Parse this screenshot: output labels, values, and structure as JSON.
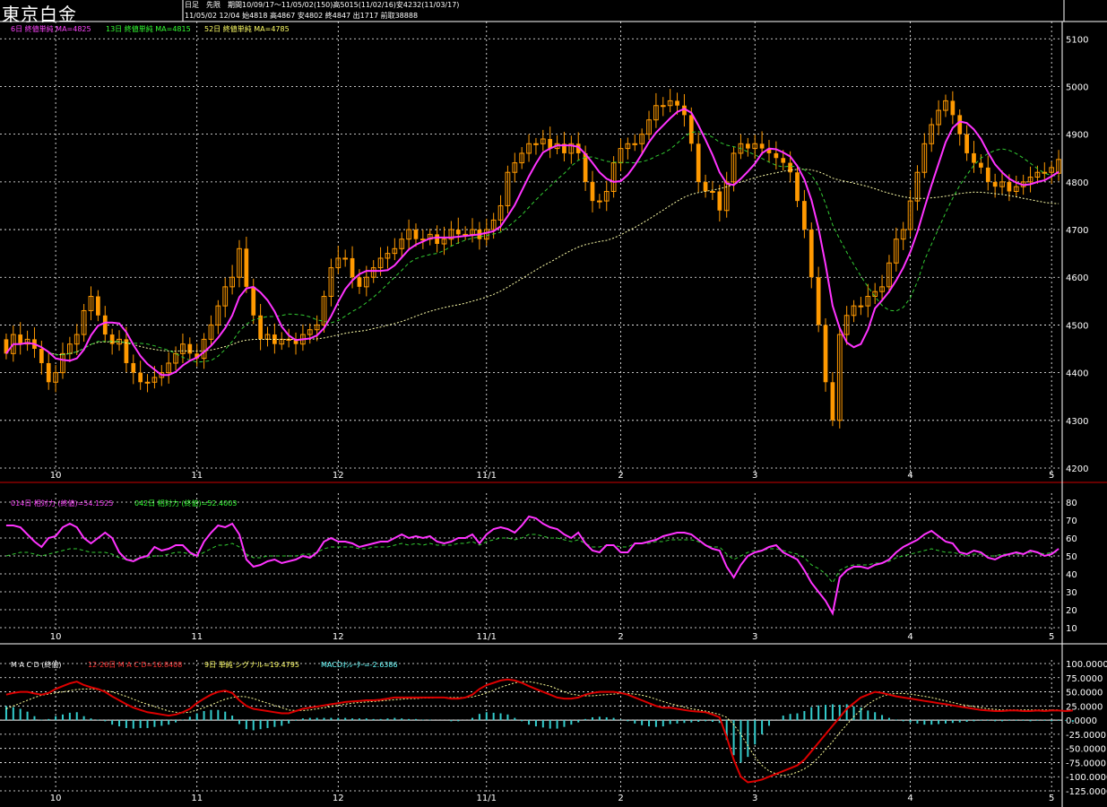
{
  "header": {
    "title": "東京白金",
    "info_line1": "日足　先限　期間10/09/17～11/05/02(150)高5015(11/02/16)安4232(11/03/17)",
    "info_line2": "11/05/02 12/04 始4818 高4867 安4802 終4847 出1717 前取38888"
  },
  "legend_price": [
    {
      "text": "6日 終値単純 MA=4825",
      "color": "#ff44ff"
    },
    {
      "text": "13日 終値単純 MA=4815",
      "color": "#33ff33"
    },
    {
      "text": "52日 終値単純 MA=4785",
      "color": "#ffff66"
    }
  ],
  "legend_rsi": [
    {
      "text": "014日 相対力 (終値)=54.1525",
      "color": "#ff44ff"
    },
    {
      "text": "042日 相対力 (終値)=52.4003",
      "color": "#33ff33"
    }
  ],
  "legend_macd": [
    {
      "text": "M A C D  (終値)",
      "color": "#ffffff"
    },
    {
      "text": "12-26日 M A C D=16.8408",
      "color": "#ff3333"
    },
    {
      "text": "9日 単純 シグナル=19.4795",
      "color": "#ffff66"
    },
    {
      "text": "MACDｵｼﾚｰﾀｰ=-2.6386",
      "color": "#66ffff"
    }
  ],
  "colors": {
    "candle": "#ff9900",
    "ma6": "#ff33ff",
    "ma13": "#33cc33",
    "ma52": "#ffffaa",
    "rsi14": "#ff33ff",
    "rsi42": "#33cc33",
    "macd": "#dd0000",
    "signal": "#ffff99",
    "osc": "#33cccc",
    "grid": "#ffffff",
    "frame_accent": "#cc0000"
  },
  "chart_data": [
    {
      "type": "candlestick",
      "title": "東京白金",
      "period": "10/09/17～11/05/02",
      "count": 150,
      "ylim": [
        4200,
        5140
      ],
      "y_ticks": [
        4200,
        4300,
        4400,
        4500,
        4600,
        4700,
        4800,
        4900,
        5000,
        5100
      ],
      "x_tick_labels": [
        {
          "label": "10",
          "index": 7
        },
        {
          "label": "11",
          "index": 27
        },
        {
          "label": "12",
          "index": 47
        },
        {
          "label": "11/1",
          "index": 68
        },
        {
          "label": "2",
          "index": 87
        },
        {
          "label": "3",
          "index": 106
        },
        {
          "label": "4",
          "index": 128
        },
        {
          "label": "5",
          "index": 148
        }
      ],
      "close": [
        4440,
        4480,
        4460,
        4470,
        4450,
        4420,
        4380,
        4400,
        4440,
        4460,
        4480,
        4530,
        4560,
        4520,
        4480,
        4460,
        4470,
        4420,
        4400,
        4380,
        4380,
        4390,
        4400,
        4420,
        4440,
        4460,
        4440,
        4430,
        4470,
        4500,
        4540,
        4580,
        4600,
        4660,
        4580,
        4520,
        4470,
        4480,
        4460,
        4470,
        4470,
        4460,
        4480,
        4490,
        4500,
        4560,
        4620,
        4640,
        4640,
        4600,
        4580,
        4600,
        4620,
        4640,
        4650,
        4660,
        4680,
        4700,
        4680,
        4680,
        4690,
        4670,
        4680,
        4700,
        4690,
        4690,
        4700,
        4680,
        4700,
        4720,
        4750,
        4820,
        4840,
        4860,
        4880,
        4880,
        4890,
        4870,
        4880,
        4860,
        4880,
        4860,
        4800,
        4760,
        4760,
        4780,
        4840,
        4870,
        4880,
        4880,
        4900,
        4930,
        4960,
        4960,
        4970,
        4960,
        4940,
        4880,
        4800,
        4780,
        4780,
        4740,
        4800,
        4860,
        4880,
        4870,
        4880,
        4870,
        4860,
        4850,
        4840,
        4820,
        4760,
        4700,
        4600,
        4500,
        4380,
        4300,
        4480,
        4520,
        4540,
        4540,
        4560,
        4570,
        4580,
        4630,
        4680,
        4700,
        4760,
        4820,
        4880,
        4920,
        4950,
        4970,
        4940,
        4900,
        4860,
        4840,
        4830,
        4800,
        4790,
        4800,
        4780,
        4790,
        4800,
        4810,
        4820,
        4820,
        4830,
        4847
      ],
      "open": [
        4470,
        4440,
        4480,
        4460,
        4470,
        4450,
        4420,
        4380,
        4400,
        4440,
        4460,
        4480,
        4530,
        4560,
        4520,
        4480,
        4460,
        4470,
        4420,
        4400,
        4380,
        4380,
        4390,
        4400,
        4420,
        4440,
        4460,
        4440,
        4430,
        4470,
        4500,
        4540,
        4580,
        4600,
        4660,
        4580,
        4520,
        4470,
        4480,
        4460,
        4470,
        4470,
        4460,
        4480,
        4490,
        4500,
        4560,
        4620,
        4640,
        4640,
        4600,
        4580,
        4600,
        4620,
        4640,
        4650,
        4660,
        4680,
        4700,
        4680,
        4680,
        4690,
        4670,
        4680,
        4700,
        4690,
        4690,
        4700,
        4680,
        4700,
        4720,
        4750,
        4820,
        4840,
        4860,
        4880,
        4880,
        4890,
        4870,
        4880,
        4860,
        4880,
        4860,
        4800,
        4760,
        4760,
        4780,
        4840,
        4870,
        4880,
        4880,
        4900,
        4930,
        4960,
        4960,
        4970,
        4960,
        4940,
        4880,
        4800,
        4780,
        4780,
        4740,
        4800,
        4860,
        4880,
        4870,
        4880,
        4870,
        4860,
        4850,
        4840,
        4820,
        4760,
        4700,
        4600,
        4500,
        4380,
        4300,
        4480,
        4520,
        4540,
        4540,
        4560,
        4570,
        4580,
        4630,
        4680,
        4700,
        4760,
        4820,
        4880,
        4920,
        4950,
        4970,
        4940,
        4900,
        4860,
        4840,
        4830,
        4800,
        4790,
        4800,
        4780,
        4790,
        4800,
        4810,
        4820,
        4820,
        4818
      ],
      "high_low_range": [
        4232,
        5015
      ],
      "ma6_last": 4825,
      "ma13_last": 4815,
      "ma52_last": 4785
    },
    {
      "type": "line",
      "series": [
        {
          "name": "014日 相対力 (終値)",
          "last": 54.1525,
          "values": [
            67,
            67,
            66,
            62,
            58,
            55,
            60,
            61,
            66,
            68,
            66,
            60,
            57,
            60,
            63,
            60,
            52,
            48,
            47,
            49,
            50,
            55,
            53,
            54,
            56,
            56,
            52,
            50,
            58,
            63,
            67,
            66,
            68,
            62,
            48,
            44,
            45,
            47,
            48,
            46,
            47,
            48,
            50,
            49,
            52,
            58,
            60,
            58,
            58,
            57,
            55,
            56,
            57,
            58,
            58,
            60,
            62,
            60,
            61,
            60,
            61,
            58,
            57,
            58,
            60,
            60,
            62,
            57,
            62,
            65,
            66,
            65,
            63,
            67,
            72,
            71,
            68,
            66,
            65,
            62,
            60,
            63,
            57,
            53,
            52,
            56,
            56,
            52,
            52,
            57,
            57,
            58,
            59,
            61,
            62,
            63,
            63,
            62,
            59,
            56,
            54,
            53,
            44,
            38,
            45,
            50,
            52,
            53,
            55,
            56,
            52,
            50,
            48,
            42,
            35,
            30,
            25,
            18,
            38,
            42,
            44,
            44,
            43,
            45,
            46,
            48,
            52,
            55,
            57,
            59,
            62,
            64,
            61,
            58,
            57,
            52,
            51,
            53,
            52,
            49,
            48,
            50,
            51,
            52,
            51,
            53,
            52,
            50,
            51,
            54
          ]
        },
        {
          "name": "042日 相対力 (終値)",
          "last": 52.4003,
          "values": [
            50,
            51,
            52,
            52,
            51,
            50,
            51,
            52,
            53,
            54,
            54,
            53,
            52,
            52,
            52,
            51,
            49,
            48,
            48,
            49,
            49,
            50,
            50,
            51,
            52,
            52,
            51,
            50,
            52,
            54,
            56,
            56,
            57,
            55,
            51,
            49,
            49,
            50,
            50,
            50,
            50,
            50,
            51,
            51,
            52,
            54,
            55,
            55,
            55,
            55,
            54,
            54,
            55,
            55,
            55,
            56,
            57,
            56,
            57,
            56,
            57,
            56,
            56,
            56,
            57,
            57,
            58,
            56,
            58,
            59,
            60,
            60,
            59,
            60,
            62,
            62,
            61,
            60,
            60,
            59,
            58,
            59,
            57,
            55,
            55,
            56,
            56,
            55,
            55,
            57,
            57,
            57,
            58,
            58,
            59,
            59,
            59,
            59,
            58,
            56,
            55,
            55,
            51,
            48,
            50,
            52,
            53,
            53,
            54,
            54,
            53,
            52,
            51,
            49,
            45,
            43,
            40,
            35,
            42,
            44,
            45,
            45,
            45,
            46,
            46,
            47,
            49,
            50,
            51,
            52,
            53,
            54,
            53,
            52,
            52,
            51,
            50,
            51,
            51,
            50,
            50,
            51,
            51,
            51,
            51,
            52,
            52,
            51,
            52,
            52
          ]
        }
      ],
      "ylim": [
        10,
        80
      ],
      "y_ticks": [
        10,
        20,
        30,
        40,
        50,
        60,
        70,
        80
      ]
    },
    {
      "type": "line",
      "series": [
        {
          "name": "12-26日 M A C D",
          "last": 16.8408,
          "values": [
            45,
            48,
            50,
            50,
            47,
            45,
            48,
            55,
            60,
            65,
            68,
            62,
            58,
            55,
            50,
            42,
            35,
            28,
            22,
            18,
            14,
            12,
            10,
            8,
            10,
            14,
            20,
            30,
            38,
            45,
            50,
            52,
            48,
            35,
            25,
            20,
            18,
            16,
            14,
            12,
            12,
            16,
            20,
            22,
            24,
            26,
            28,
            30,
            32,
            33,
            34,
            35,
            35,
            36,
            38,
            40,
            40,
            40,
            40,
            40,
            40,
            40,
            40,
            38,
            38,
            40,
            45,
            55,
            62,
            66,
            70,
            72,
            70,
            66,
            60,
            55,
            50,
            45,
            40,
            38,
            38,
            40,
            45,
            48,
            50,
            50,
            50,
            48,
            45,
            40,
            35,
            30,
            25,
            22,
            22,
            20,
            18,
            16,
            15,
            14,
            10,
            5,
            -30,
            -70,
            -100,
            -110,
            -108,
            -105,
            -100,
            -95,
            -90,
            -85,
            -80,
            -70,
            -55,
            -40,
            -25,
            -10,
            5,
            20,
            30,
            40,
            45,
            50,
            48,
            45,
            42,
            40,
            38,
            36,
            34,
            32,
            30,
            28,
            26,
            24,
            22,
            20,
            18,
            17,
            16,
            16,
            17,
            17,
            16,
            16,
            17,
            16,
            17,
            17,
            16,
            17
          ]
        },
        {
          "name": "9日 単純 シグナル",
          "last": 19.4795,
          "values": [
            20,
            25,
            30,
            35,
            40,
            44,
            46,
            48,
            50,
            52,
            54,
            55,
            55,
            54,
            52,
            50,
            46,
            42,
            37,
            32,
            28,
            24,
            20,
            16,
            14,
            13,
            14,
            18,
            22,
            27,
            32,
            37,
            40,
            42,
            41,
            38,
            34,
            30,
            26,
            22,
            18,
            17,
            17,
            18,
            20,
            22,
            24,
            26,
            28,
            30,
            31,
            32,
            33,
            34,
            35,
            36,
            37,
            38,
            38,
            39,
            39,
            40,
            40,
            40,
            40,
            40,
            41,
            44,
            48,
            53,
            58,
            62,
            66,
            68,
            68,
            66,
            63,
            60,
            55,
            50,
            46,
            44,
            43,
            43,
            44,
            45,
            46,
            47,
            47,
            46,
            44,
            41,
            37,
            33,
            29,
            26,
            23,
            20,
            18,
            16,
            13,
            10,
            5,
            -8,
            -25,
            -45,
            -65,
            -80,
            -90,
            -95,
            -98,
            -96,
            -92,
            -86,
            -78,
            -66,
            -52,
            -38,
            -22,
            -8,
            6,
            18,
            28,
            36,
            42,
            46,
            47,
            47,
            46,
            44,
            42,
            40,
            37,
            34,
            31,
            28,
            26,
            24,
            22,
            20,
            19,
            18,
            18,
            18,
            18,
            18,
            18,
            18,
            18,
            18
          ]
        },
        {
          "name": "MACDｵｼﾚｰﾀｰ",
          "last": -2.6386,
          "values": [
            25,
            23,
            20,
            15,
            7,
            1,
            2,
            7,
            10,
            13,
            14,
            7,
            3,
            1,
            -2,
            -8,
            -11,
            -14,
            -15,
            -14,
            -14,
            -12,
            -10,
            -8,
            -4,
            1,
            6,
            12,
            16,
            18,
            18,
            15,
            8,
            -7,
            -16,
            -18,
            -16,
            -14,
            -12,
            -10,
            -6,
            -1,
            3,
            4,
            4,
            4,
            4,
            4,
            4,
            3,
            3,
            3,
            2,
            2,
            3,
            4,
            3,
            2,
            2,
            1,
            1,
            0,
            0,
            -2,
            -2,
            0,
            4,
            11,
            14,
            13,
            12,
            10,
            4,
            -2,
            -8,
            -11,
            -13,
            -15,
            -15,
            -12,
            -8,
            -4,
            2,
            5,
            6,
            5,
            4,
            1,
            -2,
            -6,
            -9,
            -11,
            -12,
            -11,
            -7,
            -6,
            -5,
            -4,
            -3,
            -2,
            -3,
            -5,
            -35,
            -62,
            -75,
            -65,
            -43,
            -25,
            -10,
            0,
            8,
            11,
            12,
            16,
            23,
            26,
            27,
            28,
            27,
            28,
            24,
            22,
            17,
            14,
            9,
            4,
            1,
            -2,
            -4,
            -6,
            -8,
            -8,
            -7,
            -6,
            -5,
            -4,
            -3,
            -2,
            -1,
            -1,
            -2,
            -2,
            -1,
            -1,
            -1,
            -2,
            -1,
            -1,
            -2,
            -1,
            -1,
            -3
          ]
        }
      ],
      "ylim": [
        -125,
        100
      ],
      "y_ticks": [
        "100.0000",
        "75.0000",
        "50.0000",
        "25.0000",
        "0.0000",
        "-25.0000",
        "-50.0000",
        "-75.0000",
        "-100.0000",
        "-125.0000"
      ]
    }
  ]
}
